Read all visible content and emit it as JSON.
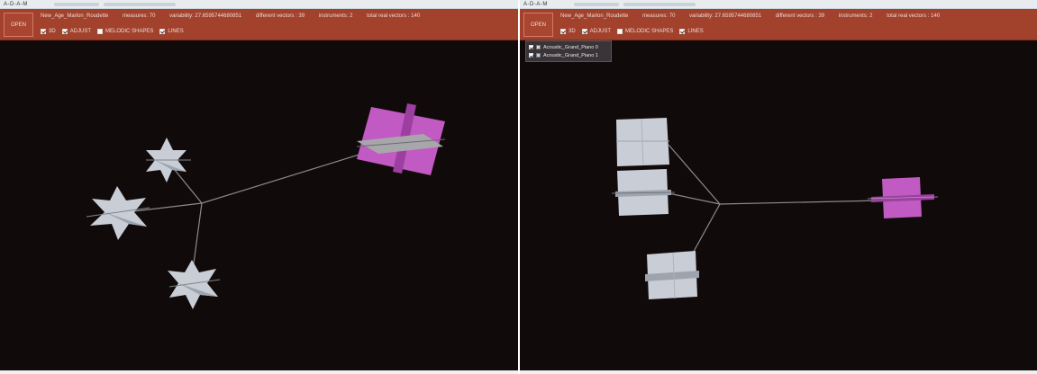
{
  "app_title": "A-D-A-M",
  "open_label": "OPEN",
  "info": {
    "file": "New_Age_Marlon_Roudette",
    "measures": "measures: 70",
    "variability": "variability: 27.6595744680851",
    "different_vectors": "different vectors : 39",
    "instruments": "instruments: 2",
    "total_vectors": "total real vectors : 140"
  },
  "options": [
    {
      "label": "3D",
      "checked": true
    },
    {
      "label": "ADJUST",
      "checked": true
    },
    {
      "label": "MELODIC SHAPES",
      "checked": false
    },
    {
      "label": "LINES",
      "checked": true
    }
  ],
  "instrument_list": [
    {
      "label": "Acoustic_Grand_Piano 0",
      "checked": true,
      "color": "#d8d8e0"
    },
    {
      "label": "Acoustic_Grand_Piano 1",
      "checked": true,
      "color": "#b9d1e6"
    }
  ],
  "colors": {
    "toolbar": "#a2412c",
    "viewport_bg": "#110a0b",
    "shape_gray": "#c9ced6",
    "shape_magenta": "#c25ac3",
    "line": "#8a8a8a"
  }
}
